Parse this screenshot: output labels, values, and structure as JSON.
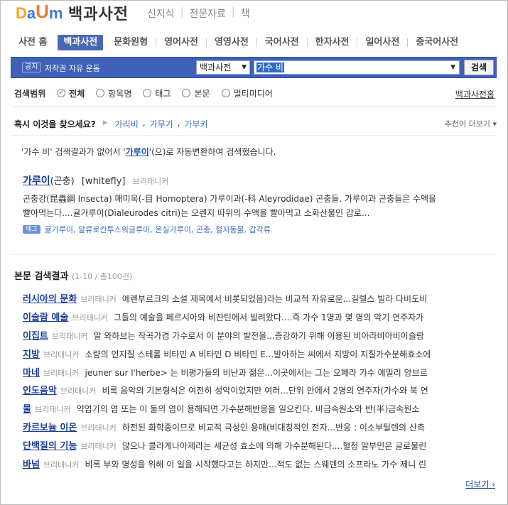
{
  "header": {
    "logo": {
      "d": "D",
      "a": "a",
      "u": "U",
      "m": "m"
    },
    "brand": "백과사전",
    "sub_links": [
      "신지식",
      "전문자료",
      "책"
    ]
  },
  "tabs": [
    "사전 홈",
    "백과사전",
    "문화원형",
    "영어사전",
    "영영사전",
    "국어사전",
    "한자사전",
    "일어사전",
    "중국어사전"
  ],
  "active_tab": "백과사전",
  "searchbar": {
    "notice_badge": "공지",
    "notice_text": "저작권 자유 운동",
    "category": "백과사전",
    "query": "가수 비",
    "button": "검색"
  },
  "scope": {
    "label": "검색범위",
    "options": [
      "전체",
      "항목명",
      "태그",
      "본문",
      "멀티미디어"
    ],
    "home_link": "백과사전홈"
  },
  "suggest": {
    "question": "혹시 이것을 찾으세요?",
    "items": [
      "가리비",
      "가무기",
      "가부키"
    ],
    "more": "추천어 더보기"
  },
  "autoconv": {
    "quote": "가수 비",
    "text1": "검색결과가 없어서",
    "converted": "가루이",
    "text2": "(으)로 자동변환하여 검색했습니다."
  },
  "entry": {
    "title": "가루이",
    "title_suffix": "(곤충)",
    "english": "[whitefly]",
    "source": "브리태니커",
    "line1": "곤충강(昆蟲綱 Insecta) 매미목(-目 Homoptera) 가루이과(-科 Aleyrodidae) 곤충들. 가루이과 곤충들은 수액을",
    "line2": "빨아먹는다....귤가루이(Dialeurodes citri)는 오렌지 따위의 수액을 빨아먹고 소화산물인 감로...",
    "tag_badge": "태그",
    "tags": "귤가루이, 알류로칸투스워글루미, 온실가루이, 곤충, 절지동물, 갑각류"
  },
  "section": {
    "title": "본문 검색결과",
    "count": "(1-10 / 총100건)"
  },
  "results": [
    {
      "title": "러시아의 문화",
      "source": "브리태니커",
      "text": "에렌부르크의 소설 제목에서 비롯되었음)라는 비교적 자유로운...길렐스 빌라 다비도비"
    },
    {
      "title": "이슬람 예술",
      "source": "브리태니커",
      "text": "그들의 예술을 페르시아와 비잔틴에서 빌려왔다....즉 가수 1명과 몇 명의 악기 연주자가"
    },
    {
      "title": "이집트",
      "source": "브리태니커",
      "text": "알 와하브는 작곡가겸 가수로서 이 분야의 발전을...증강하기 위해 이용된 비아라비아비이슬람"
    },
    {
      "title": "지방",
      "source": "브리태니커",
      "text": "소량의 인지질 스테롤 비타민 A 비타민 D 비타민 E...발아하는 씨에서 지방이 지질가수분해효소에"
    },
    {
      "title": "마네",
      "source": "브리태니커",
      "text": "jeuner sur l'herbe> 는 비평가들의 비난과 젊은...이곳에서는 그는 오페라 가수 에밀리 앙브르"
    },
    {
      "title": "인도음악",
      "source": "브리태니커",
      "text": "비록 음악의 기본형식은 여전히 성악이었지만 여러...단위 안에서 2명의 연주자(가수와 북 연"
    },
    {
      "title": "물",
      "source": "브리태니커",
      "text": "약염기의 염 또는 이 둘의 염이 용해되면 가수분해반응을 일으킨다. 비금속원소와 반(半)금속원소"
    },
    {
      "title": "카르보늄 이온",
      "source": "브리태니커",
      "text": "하전된 화학종이므로 비교적 극성인 용매(비대칭적인 전자...반응 : 이소부틸렌의 산촉"
    },
    {
      "title": "단백질의 기능",
      "source": "브리태니커",
      "text": "않으나 콜라게나아제라는 세균성 효소에 의해 가수분해된다....혈청 알부민은 글로불린"
    },
    {
      "title": "바넘",
      "source": "브리태니커",
      "text": "비록 부와 명성을 위해 이 일을 시작했다고는 하지만...적도 없는 스웨덴의 소프라노 가수 제니 린"
    }
  ],
  "more": "더보기"
}
